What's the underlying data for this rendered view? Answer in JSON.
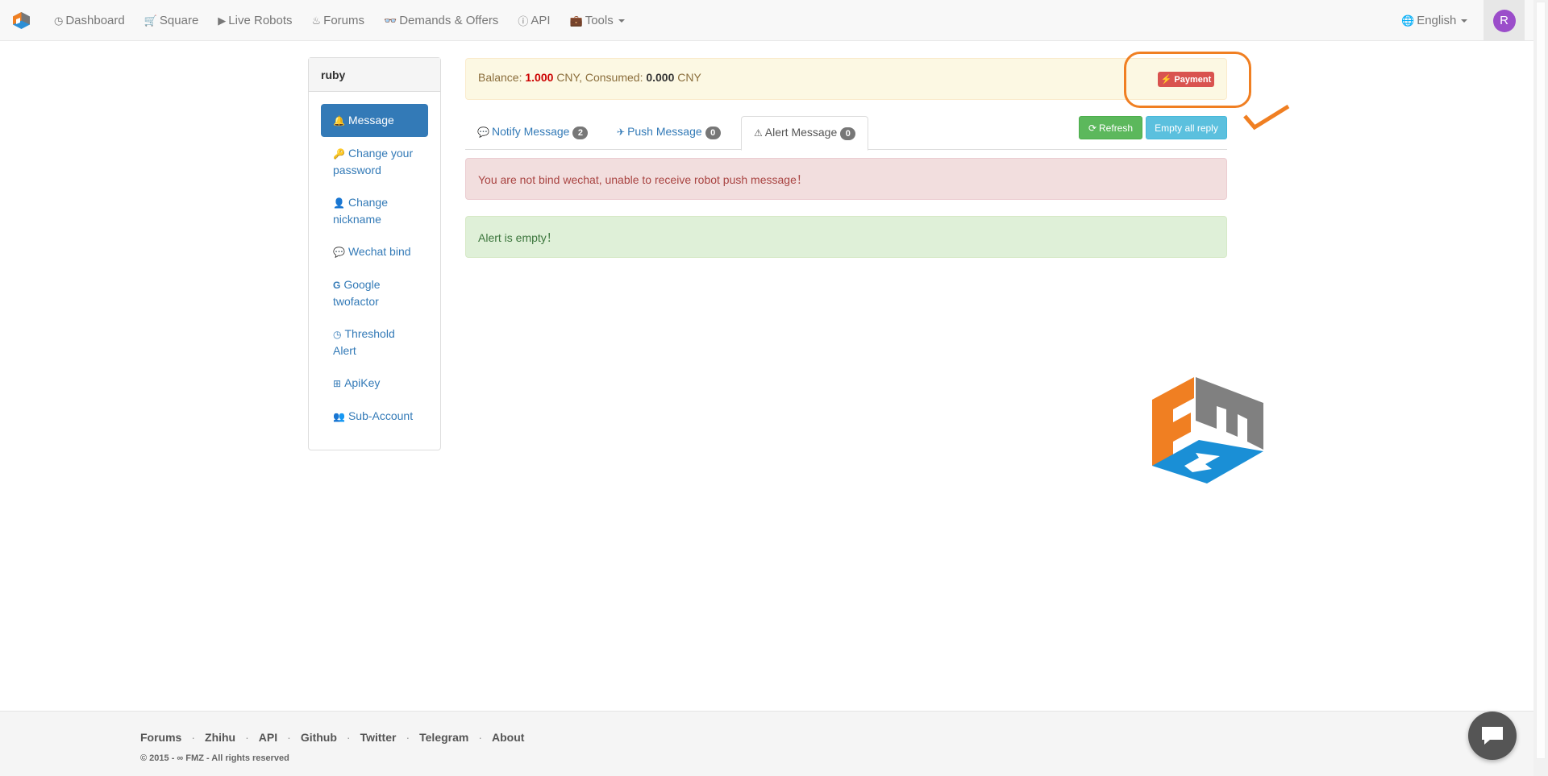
{
  "navbar": {
    "items": [
      {
        "icon": "dashboard-icon",
        "glyph": "◷",
        "label": "Dashboard"
      },
      {
        "icon": "cart-icon",
        "glyph": "🛒",
        "label": "Square"
      },
      {
        "icon": "play-circle-icon",
        "glyph": "▶",
        "label": "Live Robots"
      },
      {
        "icon": "fire-icon",
        "glyph": "♨",
        "label": "Forums"
      },
      {
        "icon": "binoculars-icon",
        "glyph": "👓",
        "label": "Demands & Offers"
      },
      {
        "icon": "info-circle-icon",
        "glyph": "ⓘ",
        "label": "API"
      },
      {
        "icon": "briefcase-icon",
        "glyph": "💼",
        "label": "Tools"
      }
    ],
    "language": {
      "icon": "globe-icon",
      "label": "English"
    },
    "avatar_letter": "R"
  },
  "sidebar": {
    "username": "ruby",
    "items": [
      {
        "icon": "bell-icon",
        "glyph": "🔔",
        "label": "Message",
        "active": true
      },
      {
        "icon": "key-icon",
        "glyph": "🔑",
        "label": "Change your password"
      },
      {
        "icon": "user-icon",
        "glyph": "👤",
        "label": "Change nickname"
      },
      {
        "icon": "wechat-icon",
        "glyph": "💬",
        "label": "Wechat bind"
      },
      {
        "icon": "google-icon",
        "glyph": "G",
        "label": "Google twofactor"
      },
      {
        "icon": "clock-icon",
        "glyph": "◷",
        "label": "Threshold Alert"
      },
      {
        "icon": "sitemap-icon",
        "glyph": "⊞",
        "label": "ApiKey"
      },
      {
        "icon": "users-icon",
        "glyph": "👥",
        "label": "Sub-Account"
      }
    ]
  },
  "balance": {
    "balance_label": "Balance:",
    "balance_value": "1.000",
    "currency": "CNY",
    "consumed_label": "Consumed:",
    "consumed_value": "0.000",
    "payment_label": "Payment"
  },
  "tabs": [
    {
      "label": "Notify Message",
      "count": "2",
      "icon": "comments-icon"
    },
    {
      "label": "Push Message",
      "count": "0",
      "icon": "paper-plane-icon"
    },
    {
      "label": "Alert Message",
      "count": "0",
      "icon": "warning-icon",
      "active": true
    }
  ],
  "actions": {
    "refresh_label": "Refresh",
    "empty_label": "Empty all reply"
  },
  "alerts": {
    "danger": "You are not bind wechat, unable to receive robot push message！",
    "success": "Alert is empty！"
  },
  "footer": {
    "links": [
      "Forums",
      "Zhihu",
      "API",
      "Github",
      "Twitter",
      "Telegram",
      "About"
    ],
    "copyright": "© 2015 - ∞ FMZ - All rights reserved"
  },
  "colors": {
    "primary": "#337ab7",
    "danger": "#d9534f",
    "success": "#5cb85c",
    "info": "#5bc0de",
    "highlight": "#f07f22",
    "avatar": "#9b4dca"
  }
}
